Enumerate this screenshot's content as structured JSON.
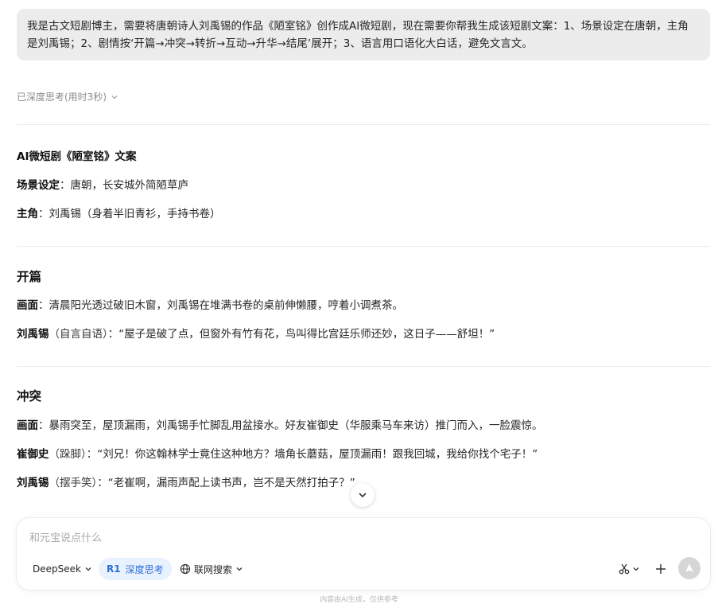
{
  "user_message": "我是古文短剧博主，需要将唐朝诗人刘禹锡的作品《陋室铭》创作成AI微短剧，现在需要你帮我生成该短剧文案：1、场景设定在唐朝，主角是刘禹锡；2、剧情按‘开篇→冲突→转折→互动→升华→结尾’展开；3、语言用口语化大白话，避免文言文。",
  "thinking": {
    "label": "已深度思考(用时3秒)"
  },
  "answer": {
    "title": "AI微短剧《陋室铭》文案",
    "setting_label": "场景设定",
    "setting_text": "：唐朝，长安城外简陋草庐",
    "lead_label": "主角",
    "lead_text": "：刘禹锡（身着半旧青衫，手持书卷）",
    "sections": [
      {
        "heading": "开篇",
        "lines": [
          {
            "speaker": "画面",
            "paren": "",
            "text": "：清晨阳光透过破旧木窗，刘禹锡在堆满书卷的桌前伸懒腰，哼着小调煮茶。"
          },
          {
            "speaker": "刘禹锡",
            "paren": "（自言自语）",
            "text": "：“屋子是破了点，但窗外有竹有花，鸟叫得比宫廷乐师还妙，这日子——舒坦！”"
          }
        ]
      },
      {
        "heading": "冲突",
        "lines": [
          {
            "speaker": "画面",
            "paren": "",
            "text": "：暴雨突至，屋顶漏雨，刘禹锡手忙脚乱用盆接水。好友崔御史（华服乘马车来访）推门而入，一脸震惊。"
          },
          {
            "speaker": "崔御史",
            "paren": "（跺脚）",
            "text": "：“刘兄！你这翰林学士竟住这种地方？墙角长蘑菇，屋顶漏雨！跟我回城，我给你找个宅子！”"
          },
          {
            "speaker": "刘禹锡",
            "paren": "（摆手笑）",
            "text": "：“老崔啊，漏雨声配上读书声，岂不是天然打拍子？”"
          }
        ]
      }
    ]
  },
  "composer": {
    "placeholder": "和元宝说点什么",
    "model_label": "DeepSeek",
    "deep_think_badge": "R1",
    "deep_think_label": "深度思考",
    "web_search_label": "联网搜索"
  },
  "footer_note": "内容由AI生成，仅供参考",
  "colors": {
    "bubble_bg": "#ececec",
    "accent_blue": "#2f6fd6",
    "accent_blue_bg": "#e8f1fe",
    "send_disabled": "#d6d6d6"
  }
}
